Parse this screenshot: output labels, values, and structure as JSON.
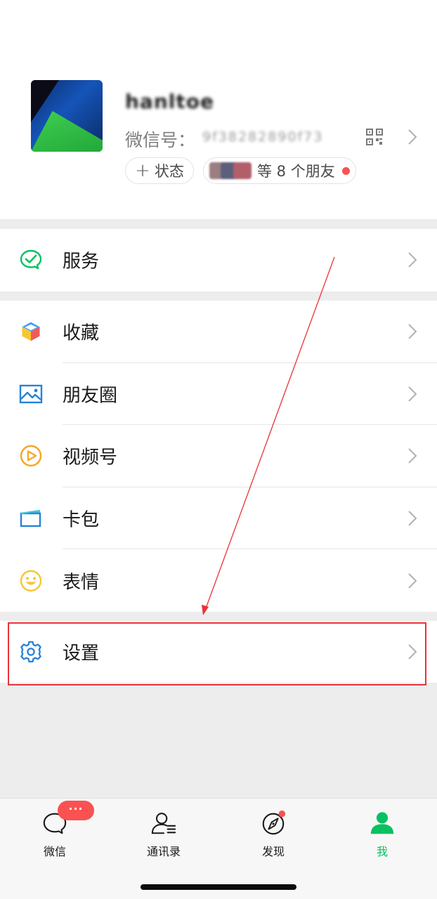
{
  "profile": {
    "nickname": "hanltoe",
    "wechat_id_label": "微信号：",
    "wechat_id_value": "9f38282890f73",
    "status_label": "状态",
    "friends_text": "等 8 个朋友",
    "icons": {
      "qr": "qr-code-icon",
      "chevron": "chevron-right-icon"
    }
  },
  "menu": {
    "service": {
      "label": "服务",
      "icon": "wechat-pay-icon",
      "color": "#07c160"
    },
    "favorites": {
      "label": "收藏",
      "icon": "cube-icon",
      "color": "#f5a623"
    },
    "moments": {
      "label": "朋友圈",
      "icon": "picture-icon",
      "color": "#2782d7"
    },
    "channels": {
      "label": "视频号",
      "icon": "play-circle-icon",
      "color": "#f5a623"
    },
    "wallet": {
      "label": "卡包",
      "icon": "card-icon",
      "color": "#2782d7"
    },
    "stickers": {
      "label": "表情",
      "icon": "smiley-icon",
      "color": "#f7c631"
    },
    "settings": {
      "label": "设置",
      "icon": "gear-icon",
      "color": "#2782d7"
    }
  },
  "annotation": {
    "color": "#e8333a"
  },
  "tabbar": {
    "chats": {
      "label": "微信",
      "badge": "···"
    },
    "contacts": {
      "label": "通讯录"
    },
    "discover": {
      "label": "发现"
    },
    "me": {
      "label": "我",
      "active_color": "#07c160"
    }
  }
}
